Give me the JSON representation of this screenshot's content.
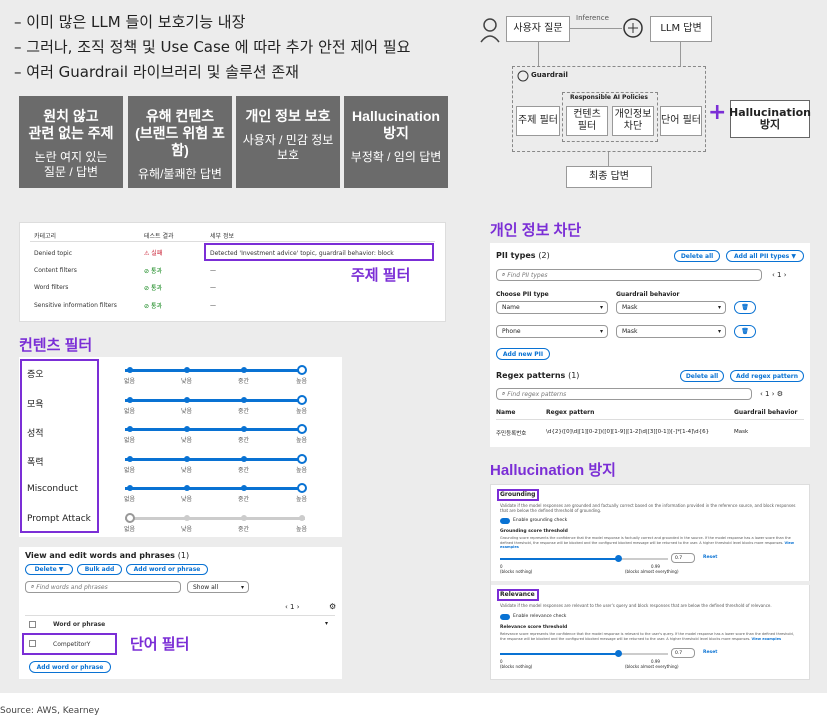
{
  "bullets": [
    "이미 많은 LLM 들이 보호기능 내장",
    "그러나, 조직 정책 및 Use Case 에 따라 추가 안전 제어 필요",
    "여러 Guardrail 라이브러리 및 솔루션 존재"
  ],
  "dark_boxes": [
    {
      "title": "원치 않고\n관련 없는 주제",
      "sub": "논란 여지 있는\n질문 / 답변"
    },
    {
      "title": "유해 컨텐츠\n(브랜드 위험 포함)",
      "sub": "유해/불쾌한 답변"
    },
    {
      "title": "개인 정보 보호",
      "sub": "사용자 / 민감 정보\n보호"
    },
    {
      "title": "Hallucination\n방지",
      "sub": "부정확 / 임의 답변"
    }
  ],
  "flow": {
    "user_question": "사용자 질문",
    "inference": "Inference",
    "llm_answer": "LLM 답변",
    "guardrail": "Guardrail",
    "responsible_ai": "Responsible   AI Policies",
    "topic_filter": "주제 필터",
    "content_filter": "컨텐츠\n필터",
    "pii_block": "개인정보\n차단",
    "word_filter": "단어 필터",
    "plus": "+",
    "hallucination": "Hallucination\n방지",
    "final_answer": "최종 답변"
  },
  "topic_panel": {
    "headers": [
      "카테고리",
      "테스트 결과",
      "세부 정보"
    ],
    "rows": [
      {
        "cat": "Denied topic",
        "result": "실패",
        "detail": "Detected 'Investment advice' topic, guardrail behavior: block"
      },
      {
        "cat": "Content filters",
        "result": "통과",
        "detail": "—"
      },
      {
        "cat": "Word filters",
        "result": "통과",
        "detail": "—"
      },
      {
        "cat": "Sensitive information filters",
        "result": "통과",
        "detail": "—"
      }
    ],
    "label": "주제 필터"
  },
  "content_panel": {
    "title": "컨텐츠 필터",
    "categories": [
      "증오",
      "모욕",
      "성적",
      "폭력",
      "Misconduct",
      "Prompt Attack"
    ],
    "levels": [
      "없음",
      "낮음",
      "중간",
      "높음"
    ]
  },
  "word_panel": {
    "heading": "View and edit words and phrases",
    "count": "(1)",
    "delete_btn": "Delete ▼",
    "bulk_btn": "Bulk add",
    "add_btn": "Add word or phrase",
    "search_placeholder": "Find words and phrases",
    "show_all": "Show all",
    "page": "1",
    "col_header": "Word or phrase",
    "row_value": "CompetitorY",
    "add_bottom": "Add word or phrase",
    "label": "단어 필터"
  },
  "pii_panel": {
    "title": "개인 정보 차단",
    "pii_types": "PII types",
    "pii_count": "(2)",
    "delete_all": "Delete all",
    "add_all": "Add all PII types ▼",
    "find_pii": "Find PII types",
    "page": "1",
    "choose_pii": "Choose PII type",
    "behavior": "Guardrail behavior",
    "rows": [
      {
        "type": "Name",
        "behavior": "Mask"
      },
      {
        "type": "Phone",
        "behavior": "Mask"
      }
    ],
    "add_new": "Add new PII",
    "regex_title": "Regex patterns",
    "regex_count": "(1)",
    "regex_delete": "Delete all",
    "regex_add": "Add regex pattern",
    "find_regex": "Find regex patterns",
    "col_name": "Name",
    "col_regex": "Regex pattern",
    "col_behavior": "Guardrail behavior",
    "regex_row": {
      "name": "주민등록번호",
      "pattern": "\\d{2}([0]\\d|[1][0-2])([0][1-9]|[1-2]\\d|[3][0-1])[-]*[1-4]\\d{6}",
      "behavior": "Mask"
    }
  },
  "hallucination_panel": {
    "title": "Hallucination 방지",
    "grounding": "Grounding",
    "grounding_desc": "Validate if the model responses are grounded and factually correct based on the information provided in the reference source, and block responses that are below the defined threshold of grounding.",
    "enable_grounding": "Enable grounding check",
    "grounding_threshold": "Grounding score threshold",
    "grounding_thr_desc": "Grounding score represents the confidence that the model response is factually correct and grounded in the source. If the model response has a lower score than the defined threshold, the response will be blocked and the configured blocked message will be returned to the user. A higher threshold level blocks more responses.",
    "view_examples": "View examples",
    "value": "0.7",
    "reset": "Reset",
    "min": "0",
    "max": "0.99",
    "min_label": "(blocks nothing)",
    "max_label": "(blocks almost everything)",
    "relevance": "Relevance",
    "relevance_desc": "Validate if the model responses are relevant to the user's query and block responses that are below the defined threshold of relevance.",
    "enable_relevance": "Enable relevance check",
    "relevance_threshold": "Relevance score threshold",
    "relevance_thr_desc": "Relevance score represents the confidence that the model response is relevant to the user's query. If the model response has a lower score than the defined threshold, the response will be blocked and the configured blocked message will be returned to the user. A higher threshold level blocks more responses."
  },
  "source": "Source: AWS, Kearney"
}
